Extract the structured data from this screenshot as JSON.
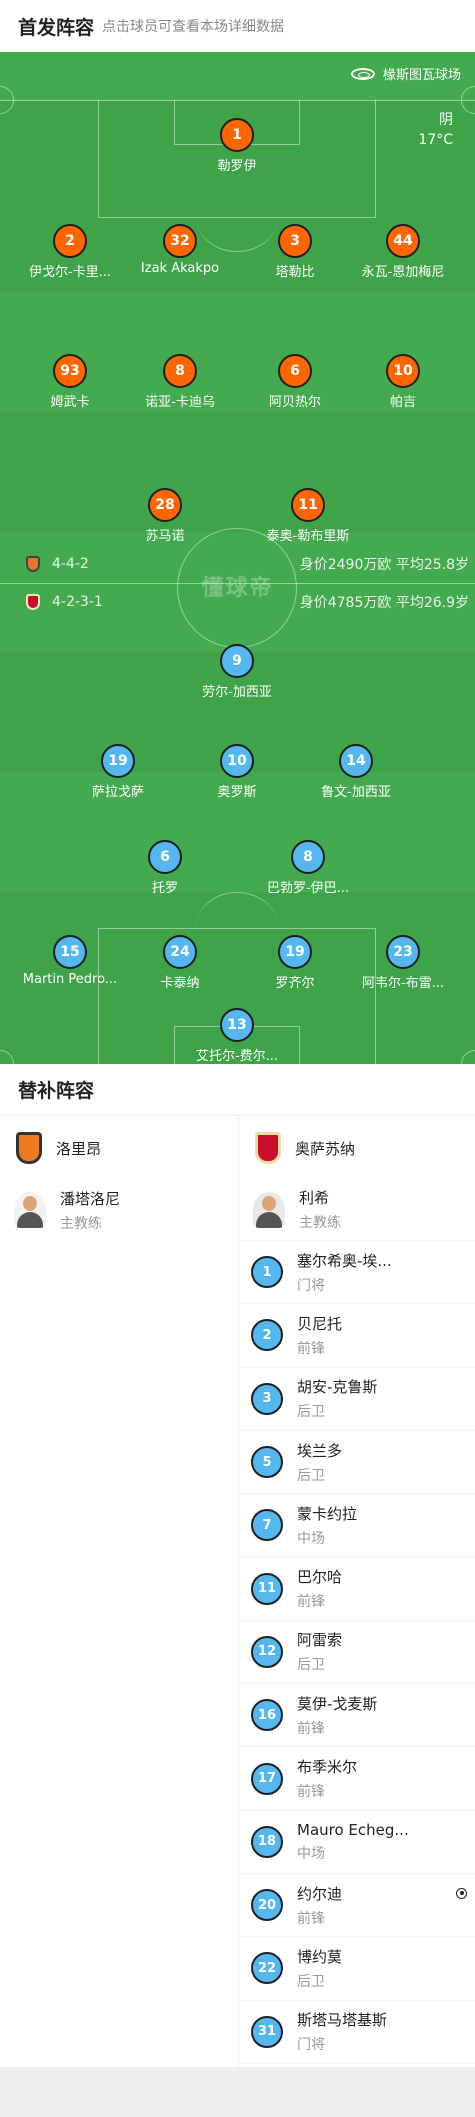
{
  "header": {
    "title": "首发阵容",
    "hint": "点击球员可查看本场详细数据"
  },
  "venue": {
    "name": "椽斯图瓦球场",
    "weather": "阴",
    "temperature": "17°C"
  },
  "watermark": "懂球帝",
  "home": {
    "formation": "4-4-2",
    "stats": "身价2490万欧 平均25.8岁",
    "color": "#ff6600",
    "players": [
      {
        "num": "1",
        "name": "勒罗伊",
        "ball": true
      },
      {
        "num": "2",
        "name": "伊戈尔-卡里..."
      },
      {
        "num": "32",
        "name": "Izak Akakpo"
      },
      {
        "num": "3",
        "name": "塔勒比"
      },
      {
        "num": "44",
        "name": "永瓦-恩加梅尼"
      },
      {
        "num": "93",
        "name": "姆武卡"
      },
      {
        "num": "8",
        "name": "诺亚-卡迪乌"
      },
      {
        "num": "6",
        "name": "阿贝热尔"
      },
      {
        "num": "10",
        "name": "帕吉"
      },
      {
        "num": "28",
        "name": "苏马诺"
      },
      {
        "num": "11",
        "name": "泰奥-勒布里斯"
      }
    ]
  },
  "away": {
    "formation": "4-2-3-1",
    "stats": "身价4785万欧 平均26.9岁",
    "color": "#55b7ef",
    "players": [
      {
        "num": "9",
        "name": "劳尔-加西亚"
      },
      {
        "num": "19",
        "name": "萨拉戈萨"
      },
      {
        "num": "10",
        "name": "奥罗斯"
      },
      {
        "num": "14",
        "name": "鲁文-加西亚"
      },
      {
        "num": "6",
        "name": "托罗"
      },
      {
        "num": "8",
        "name": "巴勃罗-伊巴..."
      },
      {
        "num": "15",
        "name": "Martin Pedro..."
      },
      {
        "num": "24",
        "name": "卡泰纳"
      },
      {
        "num": "19",
        "name": "罗齐尔"
      },
      {
        "num": "23",
        "name": "阿韦尔-布雷..."
      },
      {
        "num": "13",
        "name": "艾托尔-费尔..."
      }
    ]
  },
  "subs": {
    "title": "替补阵容",
    "left": {
      "team": "洛里昂",
      "coach": {
        "name": "潘塔洛尼",
        "role": "主教练"
      },
      "players": []
    },
    "right": {
      "team": "奥萨苏纳",
      "coach": {
        "name": "利希",
        "role": "主教练"
      },
      "players": [
        {
          "num": "1",
          "name": "塞尔希奥-埃...",
          "pos": "门将"
        },
        {
          "num": "2",
          "name": "贝尼托",
          "pos": "前锋"
        },
        {
          "num": "3",
          "name": "胡安-克鲁斯",
          "pos": "后卫"
        },
        {
          "num": "5",
          "name": "埃兰多",
          "pos": "后卫"
        },
        {
          "num": "7",
          "name": "蒙卡约拉",
          "pos": "中场"
        },
        {
          "num": "11",
          "name": "巴尔哈",
          "pos": "前锋"
        },
        {
          "num": "12",
          "name": "阿雷索",
          "pos": "后卫"
        },
        {
          "num": "16",
          "name": "莫伊-戈麦斯",
          "pos": "前锋"
        },
        {
          "num": "17",
          "name": "布季米尔",
          "pos": "前锋"
        },
        {
          "num": "18",
          "name": "Mauro Echeg...",
          "pos": "中场"
        },
        {
          "num": "20",
          "name": "约尔迪",
          "pos": "前锋",
          "ball": true
        },
        {
          "num": "22",
          "name": "博约莫",
          "pos": "后卫"
        },
        {
          "num": "31",
          "name": "斯塔马塔基斯",
          "pos": "门将"
        }
      ]
    }
  }
}
